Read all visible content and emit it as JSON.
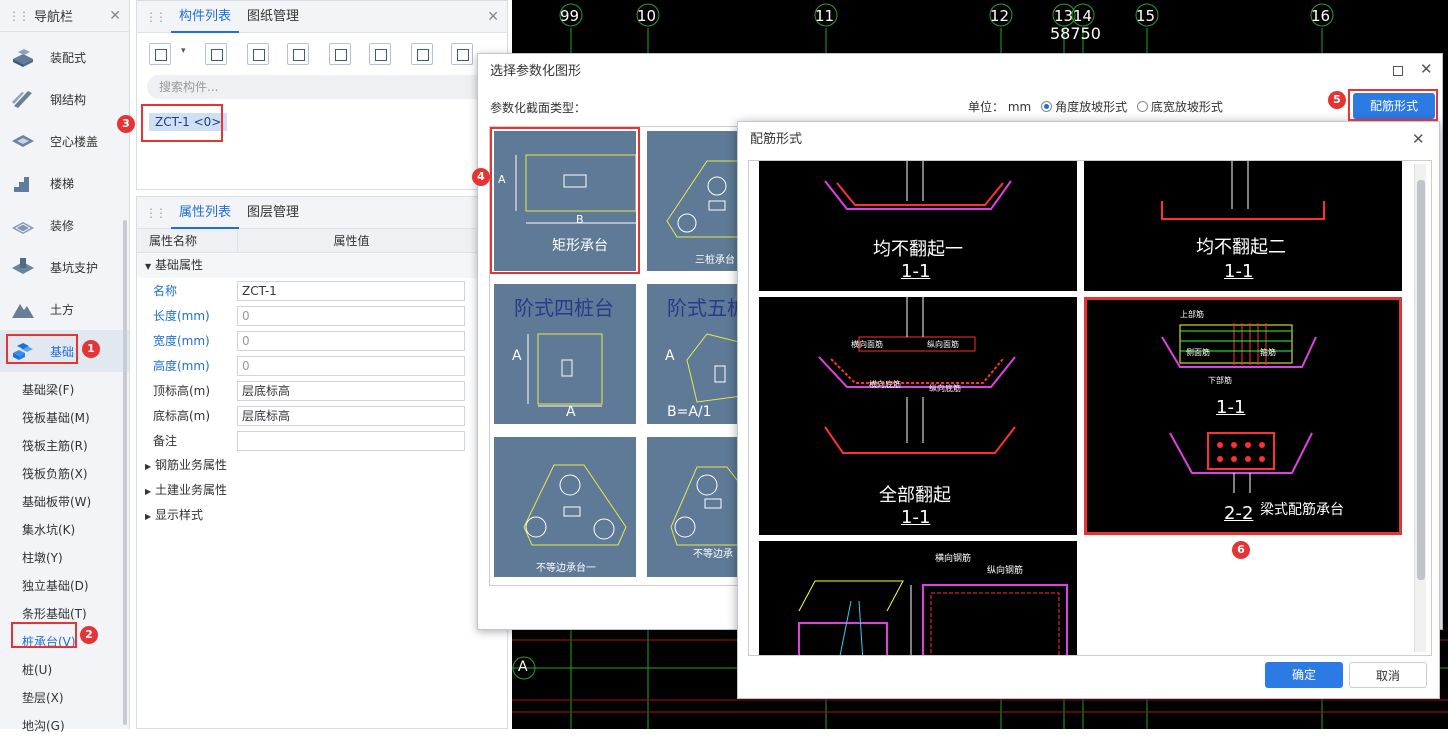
{
  "nav": {
    "title": "导航栏",
    "items": [
      {
        "label": "装配式",
        "icon": "prefab-icon"
      },
      {
        "label": "钢结构",
        "icon": "steel-icon"
      },
      {
        "label": "空心楼盖",
        "icon": "hollow-floor-icon"
      },
      {
        "label": "楼梯",
        "icon": "stairs-icon"
      },
      {
        "label": "装修",
        "icon": "decoration-icon"
      },
      {
        "label": "基坑支护",
        "icon": "pit-support-icon"
      },
      {
        "label": "土方",
        "icon": "earthwork-icon"
      },
      {
        "label": "基础",
        "icon": "foundation-icon"
      }
    ],
    "subitems": [
      "基础梁(F)",
      "筏板基础(M)",
      "筏板主筋(R)",
      "筏板负筋(X)",
      "基础板带(W)",
      "集水坑(K)",
      "柱墩(Y)",
      "独立基础(D)",
      "条形基础(T)",
      "桩承台(V)",
      "桩(U)",
      "垫层(X)",
      "地沟(G)"
    ]
  },
  "components": {
    "tabs": [
      "构件列表",
      "图纸管理"
    ],
    "search_placeholder": "搜索构件...",
    "selected": "ZCT-1 <0>"
  },
  "properties": {
    "tabs": [
      "属性列表",
      "图层管理"
    ],
    "header_name": "属性名称",
    "header_value": "属性值",
    "group_main": "基础属性",
    "rows": [
      {
        "name": "名称",
        "value": "ZCT-1"
      },
      {
        "name": "长度(mm)",
        "value": "0"
      },
      {
        "name": "宽度(mm)",
        "value": "0"
      },
      {
        "name": "高度(mm)",
        "value": "0"
      },
      {
        "name": "顶标高(m)",
        "value": "层底标高"
      },
      {
        "name": "底标高(m)",
        "value": "层底标高"
      },
      {
        "name": "备注",
        "value": ""
      }
    ],
    "groups_collapsed": [
      "钢筋业务属性",
      "土建业务属性",
      "显示样式"
    ]
  },
  "cad": {
    "axis_labels": [
      "99",
      "10",
      "11",
      "12",
      "13",
      "14",
      "15",
      "16"
    ],
    "dimension": "58750",
    "row_label": "A"
  },
  "dialog1": {
    "title": "选择参数化图形",
    "section_label": "参数化截面类型：",
    "unit_label": "单位：",
    "unit_value": "mm",
    "radio_angle": "角度放坡形式",
    "radio_width": "底宽放坡形式",
    "rebar_button": "配筋形式",
    "thumbs": [
      "矩形承台",
      "三桩承台",
      "阶式四桩台",
      "阶式五桩",
      "不等边承台一",
      "不等边承"
    ],
    "thumb_dims": {
      "A": "A",
      "B": "B",
      "bottom": "B=A/1"
    }
  },
  "dialog2": {
    "title": "配筋形式",
    "cells": [
      {
        "title": "均不翻起一",
        "section": "1-1"
      },
      {
        "title": "均不翻起二",
        "section": "1-1"
      },
      {
        "title": "全部翻起",
        "section": "1-1"
      },
      {
        "title": "梁式配筋承台",
        "section": "1-1",
        "section2": "2-2"
      },
      {
        "title": "",
        "section": ""
      }
    ],
    "labels": {
      "hengxiang_mianjin": "横向面筋",
      "zongxiang_mianjin": "纵向面筋",
      "hengxiang_dijin": "横向底筋",
      "zongxiang_dijin": "纵向底筋",
      "shangbujin": "上部筋",
      "xiabujin": "下部筋",
      "cemianjin": "侧面筋",
      "gujin": "箍筋",
      "hengxiang_gangjin": "横向钢筋",
      "zongxiang_gangjin": "纵向钢筋"
    },
    "ok": "确定",
    "cancel": "取消"
  },
  "badges": [
    "1",
    "2",
    "3",
    "4",
    "5",
    "6"
  ]
}
